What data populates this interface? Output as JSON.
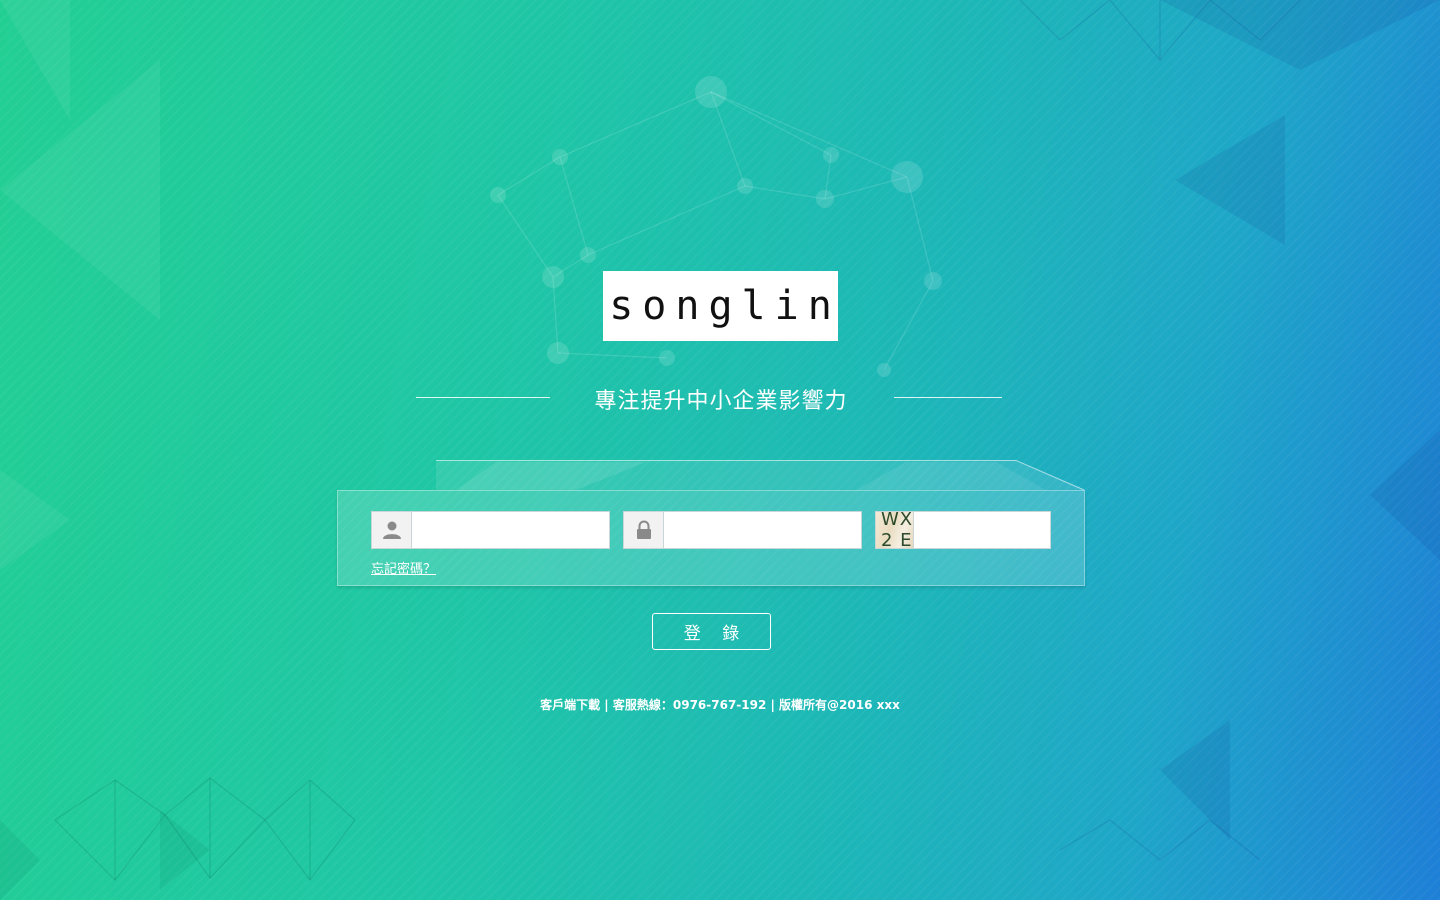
{
  "brand": {
    "logo_text": "songlin"
  },
  "tagline": "專注提升中小企業影響力",
  "form": {
    "username_icon": "user-icon",
    "password_icon": "lock-icon",
    "captcha_text": "WX 2 E",
    "forgot_password": "忘記密碼？",
    "login_button": "登 錄"
  },
  "footer": {
    "text": "客戶端下載 | 客服熱線：0976-767-192 | 版權所有@2016  xxx"
  },
  "colors": {
    "gradient_start": "#22cf93",
    "gradient_end": "#1e7fd6",
    "text": "#ffffff"
  }
}
